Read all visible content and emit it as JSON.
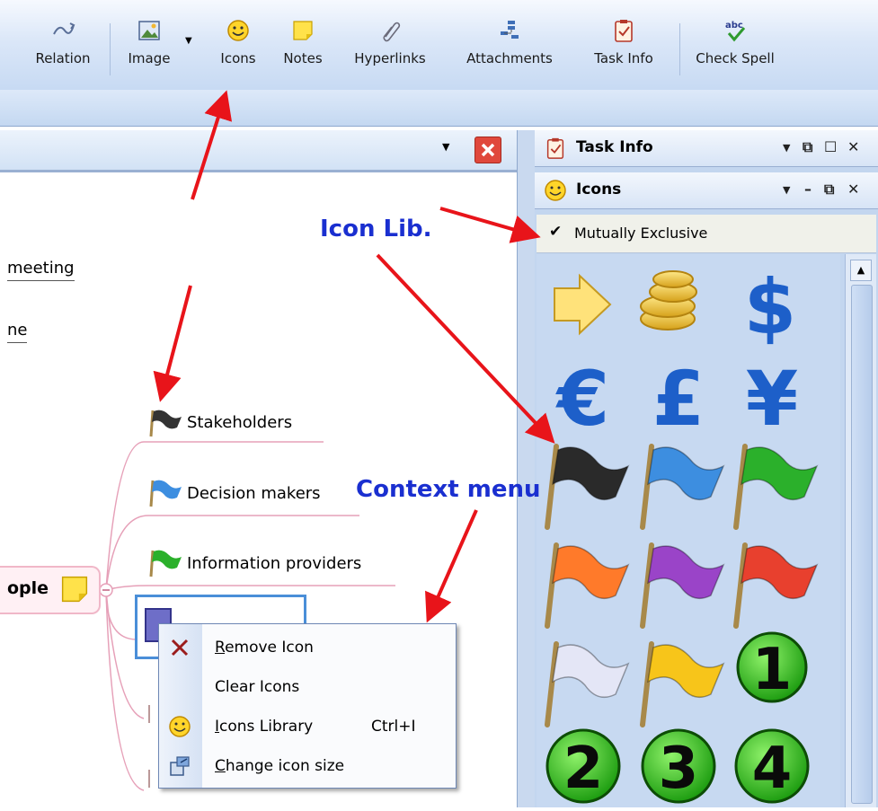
{
  "toolbar": {
    "buttons": [
      {
        "label": "Relation",
        "icon": "relation-icon"
      },
      {
        "label": "Image",
        "icon": "image-icon"
      },
      {
        "label": "Icons",
        "icon": "smiley-icon"
      },
      {
        "label": "Notes",
        "icon": "note-icon"
      },
      {
        "label": "Hyperlinks",
        "icon": "paperclip-link-icon"
      },
      {
        "label": "Attachments",
        "icon": "attachment-icon"
      },
      {
        "label": "Task Info",
        "icon": "task-info-icon"
      },
      {
        "label": "Check Spell",
        "icon": "spellcheck-icon"
      }
    ]
  },
  "map": {
    "fragments": [
      "meeting",
      "ne"
    ],
    "root_label": "ople",
    "branches": [
      "Stakeholders",
      "Decision makers",
      "Information providers"
    ]
  },
  "panels": {
    "task_info": {
      "title": "Task Info"
    },
    "icons": {
      "title": "Icons",
      "checkbox_label": "Mutually Exclusive",
      "checked": true,
      "library": [
        "arrow",
        "coins",
        "dollar",
        "euro",
        "pound",
        "yen",
        "flag-black",
        "flag-blue",
        "flag-green",
        "flag-orange",
        "flag-purple",
        "flag-red",
        "flag-white",
        "flag-yellow",
        "number-1",
        "number-2",
        "number-3",
        "number-4"
      ],
      "currency": {
        "dollar": "$",
        "euro": "€",
        "pound": "£",
        "yen": "¥"
      },
      "numbers": [
        "1",
        "2",
        "3",
        "4"
      ]
    }
  },
  "context_menu": {
    "items": [
      {
        "label": "Remove Icon",
        "accel": "R",
        "shortcut": ""
      },
      {
        "label": "Clear Icons",
        "accel": "",
        "shortcut": ""
      },
      {
        "label": "Icons Library",
        "accel": "I",
        "shortcut": "Ctrl+I"
      },
      {
        "label": "Change icon size",
        "accel": "C",
        "shortcut": ""
      }
    ]
  },
  "annotations": {
    "icon_lib": "Icon Lib.",
    "context_menu": "Context menu"
  },
  "colors": {
    "arrow": "#e8141a",
    "annotation": "#1a2fd0",
    "branch_line": "#e6a0b8"
  }
}
